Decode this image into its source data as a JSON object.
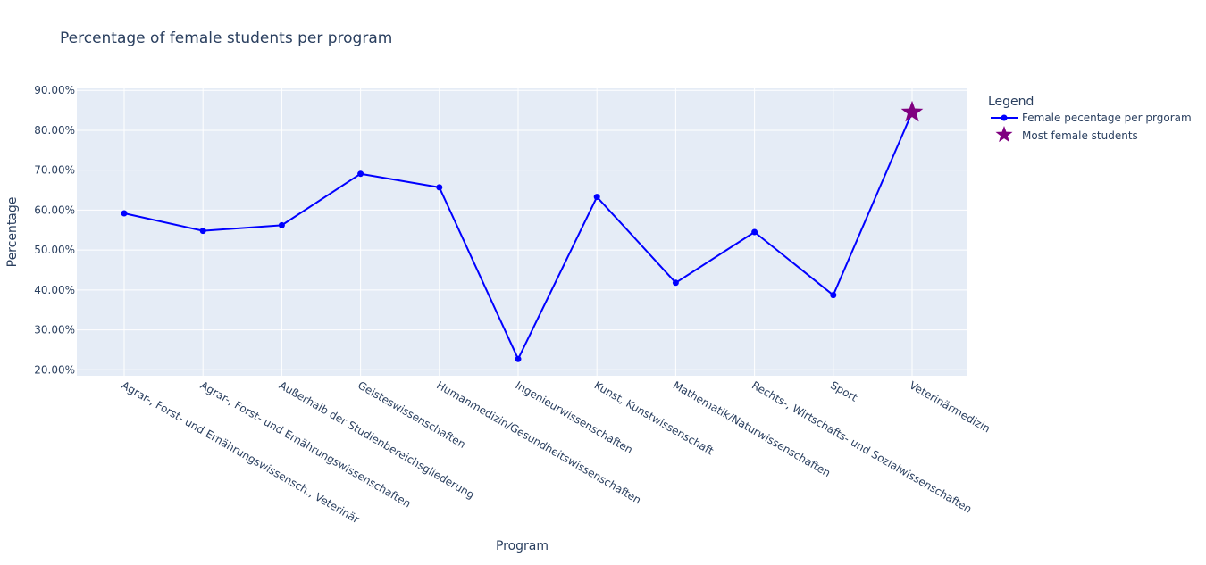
{
  "chart_data": {
    "type": "line",
    "title": "Percentage of female students per program",
    "xlabel": "Program",
    "ylabel": "Percentage",
    "categories": [
      "Agrar-, Forst- und Ernährungswissensch., Veterinär",
      "Agrar-, Forst- und Ernährungswissenschaften",
      "Außerhalb der Studienbereichsgliederung",
      "Geisteswissenschaften",
      "Humanmedizin/Gesundheitswissenschaften",
      "Ingenieurwissenschaften",
      "Kunst, Kunstwissenschaft",
      "Mathematik/Naturwissenschaften",
      "Rechts-, Wirtschafts- und Sozialwissenschaften",
      "Sport",
      "Veterinärmedizin"
    ],
    "series": [
      {
        "name": "Female pecentage per prgoram",
        "values": [
          59.2,
          54.8,
          56.2,
          69.1,
          65.7,
          22.7,
          63.3,
          41.8,
          54.5,
          38.7,
          84.5
        ],
        "color": "#0000ff",
        "marker": "circle"
      },
      {
        "name": "Most female students",
        "x": "Veterinärmedizin",
        "values": [
          84.5
        ],
        "color": "#800080",
        "marker": "star"
      }
    ],
    "ylim": [
      18.5,
      90.5
    ],
    "yticks": [
      20,
      30,
      40,
      50,
      60,
      70,
      80,
      90
    ],
    "ytick_labels": [
      "20.00%",
      "30.00%",
      "40.00%",
      "50.00%",
      "60.00%",
      "70.00%",
      "80.00%",
      "90.00%"
    ],
    "grid": true,
    "legend": {
      "title": "Legend",
      "position": "top-right"
    }
  }
}
